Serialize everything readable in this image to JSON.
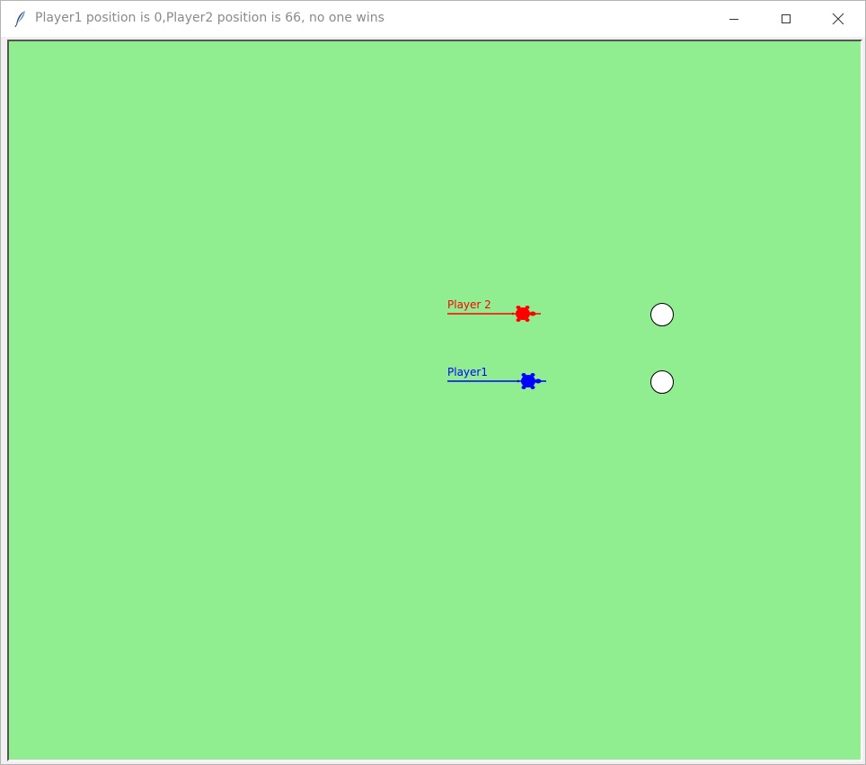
{
  "window": {
    "title": "Player1 position is 0,Player2 position is 66, no one wins",
    "icon": "feather-icon",
    "controls": [
      "minimize-icon",
      "maximize-icon",
      "close-icon"
    ]
  },
  "game": {
    "background_color": "#90ee90",
    "players": [
      {
        "label": "Player 2",
        "color": "#ff0000",
        "position": 66
      },
      {
        "label": "Player1",
        "color": "#0000ff",
        "position": 0
      }
    ],
    "targets": [
      {
        "name": "target-circle-player2",
        "fill": "#ffffff"
      },
      {
        "name": "target-circle-player1",
        "fill": "#ffffff"
      }
    ]
  }
}
